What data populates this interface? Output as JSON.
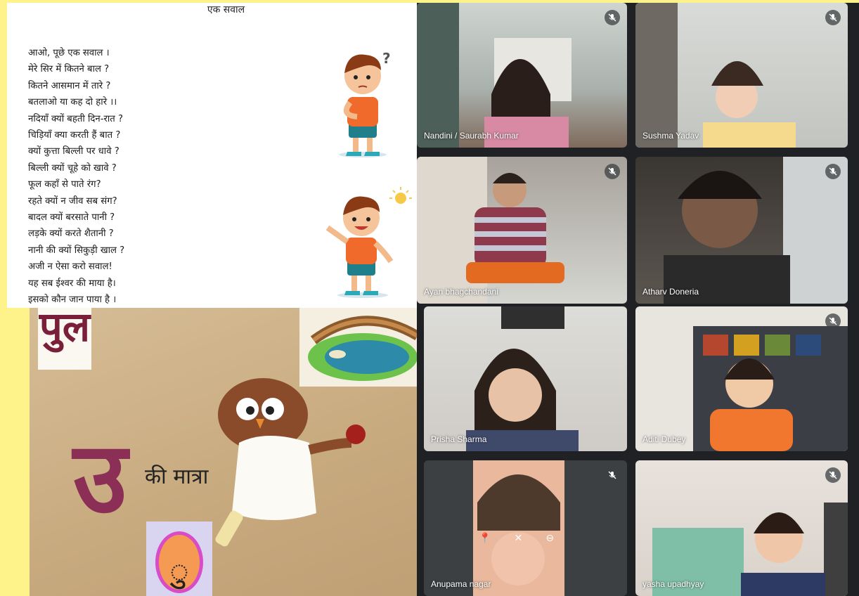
{
  "poem": {
    "title": "एक सवाल",
    "lines": [
      "आओ, पूछे एक सवाल ।",
      "मेरे सिर में कितने बाल ?",
      "कितने आसमान में तारे ?",
      "बतलाओ या कह दो हारे ।।",
      "नदियाँ क्यों बहती दिन-रात ?",
      "चिड़ियाँ क्या करती हैं बात ?",
      "क्यों कुत्ता बिल्ली पर धावे ?",
      "बिल्ली क्यों चूहे को खावे ?",
      "फूल कहाँ से पाते रंग?",
      "रहते क्यों न जीव सब संग?",
      "बादल क्यों बरसाते पानी ?",
      "लड़के क्यों करते शैतानी ?",
      "नानी की क्यों सिकुड़ी खाल ?",
      "अजी न ऐसा करो सवाल!",
      "यह सब ईश्वर की माया है।",
      "इसको कौन जान पाया है ।"
    ]
  },
  "lesson": {
    "word": "पुल",
    "letter": "उ",
    "matra_label": "की मात्रा",
    "matra_sign": "ु"
  },
  "participants": [
    {
      "name": "Nandini / Saurabh Kumar"
    },
    {
      "name": "Sushma Yadav"
    },
    {
      "name": "Ayan bhagchandani"
    },
    {
      "name": "Atharv Doneria"
    },
    {
      "name": "Prisha Sharma"
    },
    {
      "name": "Aditi Dubey"
    },
    {
      "name": "Anupama nagar"
    },
    {
      "name": "yasha upadhyay"
    }
  ],
  "icons": {
    "mic": "mic-off-icon",
    "question": "question-icon",
    "bulb": "lightbulb-icon"
  },
  "colors": {
    "background": "#fdf38a",
    "meet_grid": "#202124",
    "matra_purple": "#8b2f57"
  }
}
